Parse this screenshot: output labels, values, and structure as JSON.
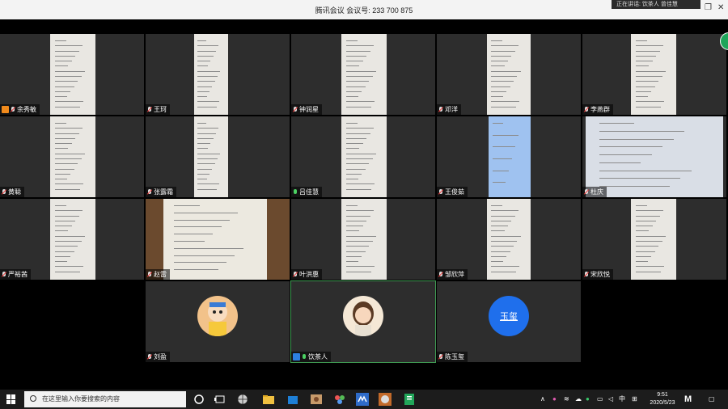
{
  "window": {
    "title": "腾讯会议 会议号: 233 700 875",
    "speaking_label": "正在讲话: 饮茶人 曾佳慧"
  },
  "participants": [
    {
      "name": "余秀敏",
      "row": 0,
      "col": 0,
      "mic": "muted",
      "host": true,
      "scene": "paper"
    },
    {
      "name": "王珂",
      "row": 0,
      "col": 1,
      "mic": "muted",
      "scene": "paper"
    },
    {
      "name": "钟润星",
      "row": 0,
      "col": 2,
      "mic": "muted",
      "scene": "paper"
    },
    {
      "name": "邓洋",
      "row": 0,
      "col": 3,
      "mic": "muted",
      "scene": "paper"
    },
    {
      "name": "李燕群",
      "row": 0,
      "col": 4,
      "mic": "muted",
      "scene": "paper"
    },
    {
      "name": "黄聪",
      "row": 1,
      "col": 0,
      "mic": "muted",
      "scene": "paper"
    },
    {
      "name": "张露霜",
      "row": 1,
      "col": 1,
      "mic": "muted",
      "scene": "paper"
    },
    {
      "name": "吕佳慧",
      "row": 1,
      "col": 2,
      "mic": "on",
      "scene": "paper"
    },
    {
      "name": "王俊茹",
      "row": 1,
      "col": 3,
      "mic": "muted",
      "scene": "blue"
    },
    {
      "name": "杜庆",
      "row": 1,
      "col": 4,
      "mic": "muted",
      "scene": "wide"
    },
    {
      "name": "严裕茜",
      "row": 2,
      "col": 0,
      "mic": "muted",
      "scene": "paper"
    },
    {
      "name": "赵雷",
      "row": 2,
      "col": 1,
      "mic": "muted",
      "scene": "book"
    },
    {
      "name": "叶洪惠",
      "row": 2,
      "col": 2,
      "mic": "muted",
      "scene": "paper"
    },
    {
      "name": "邹欣萍",
      "row": 2,
      "col": 3,
      "mic": "muted",
      "scene": "paper"
    },
    {
      "name": "宋欣悦",
      "row": 2,
      "col": 4,
      "mic": "muted",
      "scene": "paper"
    },
    {
      "name": "刘盈",
      "row": 3,
      "col": 1,
      "mic": "muted",
      "scene": "avatar-cartoon"
    },
    {
      "name": "饮茶人",
      "row": 3,
      "col": 2,
      "mic": "on",
      "host": true,
      "hostColor": "blue",
      "active": true,
      "scene": "avatar-girl"
    },
    {
      "name": "陈玉玺",
      "row": 3,
      "col": 3,
      "mic": "muted",
      "scene": "avatar-text",
      "avatar_text": "玉玺"
    }
  ],
  "taskbar": {
    "search_placeholder": "在这里输入你要搜索的内容",
    "ime_label": "中",
    "time": "9:51",
    "date": "2020/5/23"
  },
  "colors": {
    "tile_bg": "#2d2d2d",
    "active_border": "#3f9a52",
    "avatar_blue": "#1f6fec",
    "taskbar": "#1c1c1c"
  }
}
